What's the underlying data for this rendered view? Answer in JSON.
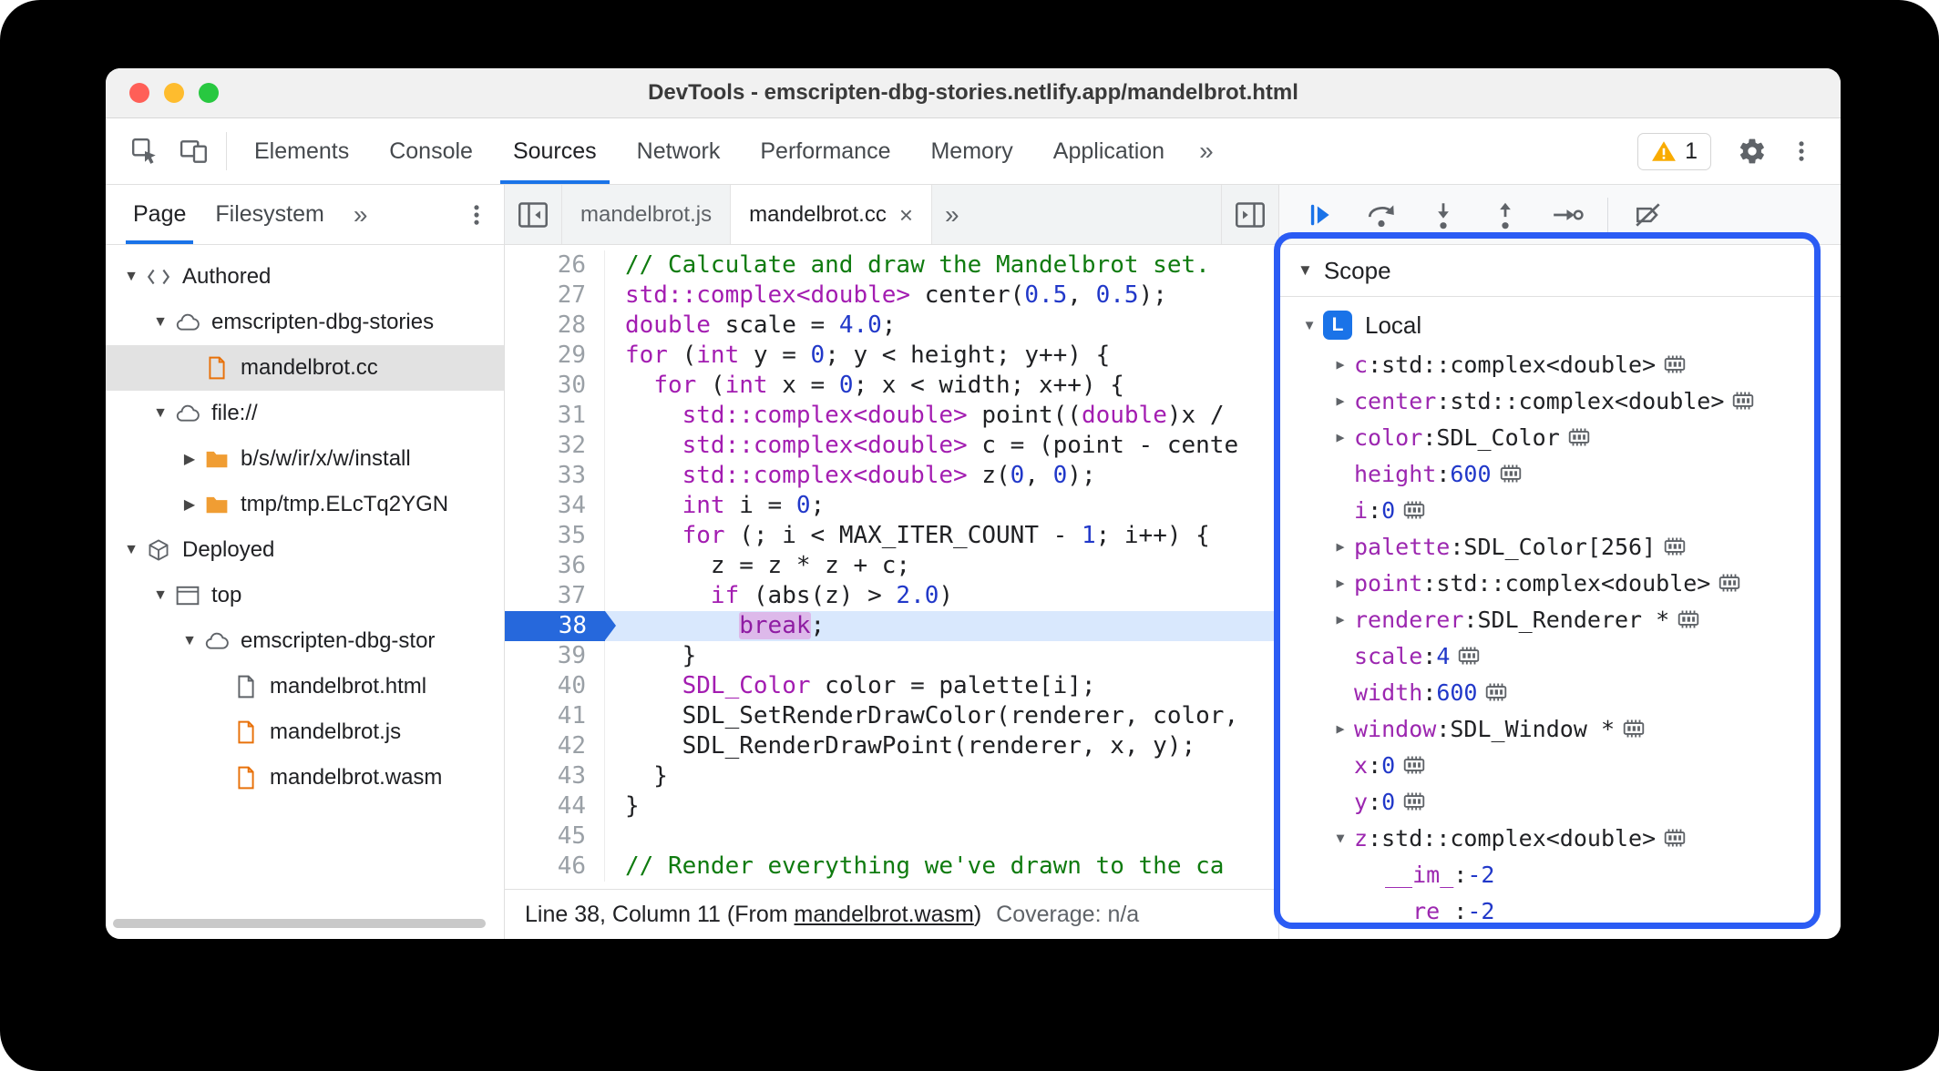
{
  "window": {
    "title": "DevTools - emscripten-dbg-stories.netlify.app/mandelbrot.html"
  },
  "toolbar": {
    "icons": [
      "inspect",
      "device-toolbar"
    ],
    "tabs": [
      "Elements",
      "Console",
      "Sources",
      "Network",
      "Performance",
      "Memory",
      "Application"
    ],
    "selected_tab": "Sources",
    "more_tabs": "»",
    "issues": {
      "count": "1"
    },
    "right_icons": [
      "settings",
      "menu"
    ]
  },
  "navigator": {
    "tabs": [
      "Page",
      "Filesystem"
    ],
    "selected_tab": "Page",
    "more_tabs": "»",
    "tree": [
      {
        "label": "Authored",
        "icon": "code-brackets",
        "state": "open",
        "depth": 0
      },
      {
        "label": "emscripten-dbg-stories",
        "icon": "cloud",
        "state": "open",
        "depth": 1
      },
      {
        "label": "mandelbrot.cc",
        "icon": "file-orange",
        "state": "none",
        "depth": 2,
        "selected": true
      },
      {
        "label": "file://",
        "icon": "cloud",
        "state": "open",
        "depth": 1
      },
      {
        "label": "b/s/w/ir/x/w/install",
        "icon": "folder",
        "state": "closed",
        "depth": 2
      },
      {
        "label": "tmp/tmp.ELcTq2YGN",
        "icon": "folder",
        "state": "closed",
        "depth": 2
      },
      {
        "label": "Deployed",
        "icon": "cube",
        "state": "open",
        "depth": 0
      },
      {
        "label": "top",
        "icon": "frame",
        "state": "open",
        "depth": 1
      },
      {
        "label": "emscripten-dbg-stor",
        "icon": "cloud",
        "state": "open",
        "depth": 2
      },
      {
        "label": "mandelbrot.html",
        "icon": "file-gray",
        "state": "none",
        "depth": 3
      },
      {
        "label": "mandelbrot.js",
        "icon": "file-orange",
        "state": "none",
        "depth": 3
      },
      {
        "label": "mandelbrot.wasm",
        "icon": "file-orange",
        "state": "none",
        "depth": 3
      }
    ]
  },
  "editor": {
    "tabs": [
      {
        "label": "mandelbrot.js",
        "active": false,
        "close": ""
      },
      {
        "label": "mandelbrot.cc",
        "active": true,
        "close": "×"
      }
    ],
    "more_tabs": "»",
    "current_line": 38,
    "lines": [
      {
        "no": 26,
        "t": [
          [
            "c",
            "// Calculate and draw the Mandelbrot set."
          ]
        ]
      },
      {
        "no": 27,
        "t": [
          [
            "k",
            "std::complex<double>"
          ],
          [
            "p",
            " center("
          ],
          [
            "n",
            "0.5"
          ],
          [
            "p",
            ", "
          ],
          [
            "n",
            "0.5"
          ],
          [
            "p",
            ");"
          ]
        ]
      },
      {
        "no": 28,
        "t": [
          [
            "k",
            "double"
          ],
          [
            "p",
            " scale = "
          ],
          [
            "n",
            "4.0"
          ],
          [
            "p",
            ";"
          ]
        ]
      },
      {
        "no": 29,
        "t": [
          [
            "k",
            "for"
          ],
          [
            "p",
            " ("
          ],
          [
            "k",
            "int"
          ],
          [
            "p",
            " y = "
          ],
          [
            "n",
            "0"
          ],
          [
            "p",
            "; y < height; y++) {"
          ]
        ]
      },
      {
        "no": 30,
        "t": [
          [
            "p",
            "  "
          ],
          [
            "k",
            "for"
          ],
          [
            "p",
            " ("
          ],
          [
            "k",
            "int"
          ],
          [
            "p",
            " x = "
          ],
          [
            "n",
            "0"
          ],
          [
            "p",
            "; x < width; x++) {"
          ]
        ]
      },
      {
        "no": 31,
        "t": [
          [
            "p",
            "    "
          ],
          [
            "k",
            "std::complex<double>"
          ],
          [
            "p",
            " point(("
          ],
          [
            "k",
            "double"
          ],
          [
            "p",
            ")x /"
          ]
        ]
      },
      {
        "no": 32,
        "t": [
          [
            "p",
            "    "
          ],
          [
            "k",
            "std::complex<double>"
          ],
          [
            "p",
            " c = (point - cente"
          ]
        ]
      },
      {
        "no": 33,
        "t": [
          [
            "p",
            "    "
          ],
          [
            "k",
            "std::complex<double>"
          ],
          [
            "p",
            " z("
          ],
          [
            "n",
            "0"
          ],
          [
            "p",
            ", "
          ],
          [
            "n",
            "0"
          ],
          [
            "p",
            ");"
          ]
        ]
      },
      {
        "no": 34,
        "t": [
          [
            "p",
            "    "
          ],
          [
            "k",
            "int"
          ],
          [
            "p",
            " i = "
          ],
          [
            "n",
            "0"
          ],
          [
            "p",
            ";"
          ]
        ]
      },
      {
        "no": 35,
        "t": [
          [
            "p",
            "    "
          ],
          [
            "k",
            "for"
          ],
          [
            "p",
            " (; i < MAX_ITER_COUNT - "
          ],
          [
            "n",
            "1"
          ],
          [
            "p",
            "; i++) {"
          ]
        ]
      },
      {
        "no": 36,
        "t": [
          [
            "p",
            "      z = z * z + c;"
          ]
        ]
      },
      {
        "no": 37,
        "t": [
          [
            "p",
            "      "
          ],
          [
            "k",
            "if"
          ],
          [
            "p",
            " (abs(z) > "
          ],
          [
            "n",
            "2.0"
          ],
          [
            "p",
            ")"
          ]
        ]
      },
      {
        "no": 38,
        "t": [
          [
            "p",
            "        "
          ],
          [
            "kb",
            "break"
          ],
          [
            "p",
            ";"
          ]
        ]
      },
      {
        "no": 39,
        "t": [
          [
            "p",
            "    }"
          ]
        ]
      },
      {
        "no": 40,
        "t": [
          [
            "p",
            "    "
          ],
          [
            "k",
            "SDL_Color"
          ],
          [
            "p",
            " color = palette[i];"
          ]
        ]
      },
      {
        "no": 41,
        "t": [
          [
            "p",
            "    SDL_SetRenderDrawColor(renderer, color,"
          ]
        ]
      },
      {
        "no": 42,
        "t": [
          [
            "p",
            "    SDL_RenderDrawPoint(renderer, x, y);"
          ]
        ]
      },
      {
        "no": 43,
        "t": [
          [
            "p",
            "  }"
          ]
        ]
      },
      {
        "no": 44,
        "t": [
          [
            "p",
            "}"
          ]
        ]
      },
      {
        "no": 45,
        "t": [
          [
            "p",
            ""
          ]
        ]
      },
      {
        "no": 46,
        "t": [
          [
            "c",
            "// Render everything we've drawn to the ca"
          ]
        ]
      }
    ],
    "status": {
      "line_col": "Line 38, Column 11",
      "from_prefix": "(From ",
      "link": "mandelbrot.wasm",
      "from_suffix": ")",
      "coverage": "Coverage: n/a"
    }
  },
  "debugger": {
    "buttons": [
      "resume",
      "step-over",
      "step-into",
      "step-out",
      "step",
      "sep",
      "deactivate-breakpoints"
    ],
    "scope": {
      "title": "Scope",
      "local": {
        "badge": "L",
        "label": "Local"
      },
      "rows": [
        {
          "ar": "closed",
          "name": "c",
          "value": "std::complex<double>",
          "vt": "type",
          "mem": true,
          "depth": 1
        },
        {
          "ar": "closed",
          "name": "center",
          "value": "std::complex<double>",
          "vt": "type",
          "mem": true,
          "depth": 1
        },
        {
          "ar": "closed",
          "name": "color",
          "value": "SDL_Color",
          "vt": "type",
          "mem": true,
          "depth": 1
        },
        {
          "ar": "none",
          "name": "height",
          "value": "600",
          "vt": "num",
          "mem": true,
          "depth": 1
        },
        {
          "ar": "none",
          "name": "i",
          "value": "0",
          "vt": "num",
          "mem": true,
          "depth": 1
        },
        {
          "ar": "closed",
          "name": "palette",
          "value": "SDL_Color[256]",
          "vt": "type",
          "mem": true,
          "depth": 1
        },
        {
          "ar": "closed",
          "name": "point",
          "value": "std::complex<double>",
          "vt": "type",
          "mem": true,
          "depth": 1
        },
        {
          "ar": "closed",
          "name": "renderer",
          "value": "SDL_Renderer *",
          "vt": "type",
          "mem": true,
          "depth": 1
        },
        {
          "ar": "none",
          "name": "scale",
          "value": "4",
          "vt": "num",
          "mem": true,
          "depth": 1
        },
        {
          "ar": "none",
          "name": "width",
          "value": "600",
          "vt": "num",
          "mem": true,
          "depth": 1
        },
        {
          "ar": "closed",
          "name": "window",
          "value": "SDL_Window *",
          "vt": "type",
          "mem": true,
          "depth": 1
        },
        {
          "ar": "none",
          "name": "x",
          "value": "0",
          "vt": "num",
          "mem": true,
          "depth": 1
        },
        {
          "ar": "none",
          "name": "y",
          "value": "0",
          "vt": "num",
          "mem": true,
          "depth": 1
        },
        {
          "ar": "open",
          "name": "z",
          "value": "std::complex<double>",
          "vt": "type",
          "mem": true,
          "depth": 1
        },
        {
          "ar": "none",
          "name": "__im_",
          "value": "-2",
          "vt": "num",
          "mem": false,
          "depth": 2
        },
        {
          "ar": "none",
          "name": "__re_",
          "value": "-2",
          "vt": "num",
          "mem": false,
          "depth": 2
        }
      ]
    }
  },
  "colors": {
    "accent": "#1a73e8",
    "annotation_box": "#2b5cf4",
    "exec_line_bg": "#d9e8fd",
    "keyword": "#a31db1",
    "number": "#2138c9",
    "comment": "#0f7b0f",
    "property": "#9c27b0",
    "warning": "#f9ab00"
  }
}
